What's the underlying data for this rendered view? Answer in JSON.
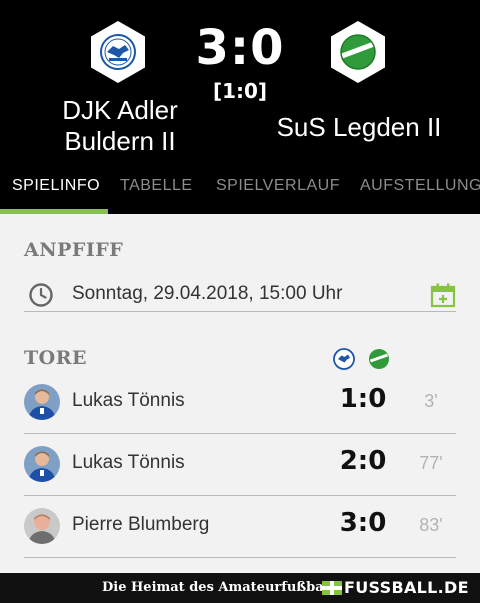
{
  "match": {
    "home_team_line1": "DJK Adler",
    "home_team_line2": "Buldern II",
    "away_team": "SuS Legden II",
    "score": "3:0",
    "halftime": "[1:0]"
  },
  "tabs": [
    "SPIELINFO",
    "TABELLE",
    "SPIELVERLAUF",
    "AUFSTELLUNG"
  ],
  "active_tab": "SPIELINFO",
  "kickoff": {
    "title": "ANPFIFF",
    "datetime": "Sonntag, 29.04.2018, 15:00 Uhr",
    "icon": "clock-icon",
    "action_icon": "calendar-add-icon"
  },
  "goals": {
    "title": "TORE",
    "items": [
      {
        "player": "Lukas Tönnis",
        "score": "1:0",
        "minute": "3'"
      },
      {
        "player": "Lukas Tönnis",
        "score": "2:0",
        "minute": "77'"
      },
      {
        "player": "Pierre Blumberg",
        "score": "3:0",
        "minute": "83'"
      }
    ]
  },
  "footer": {
    "slogan": "Die Heimat des Amateurfußballs",
    "brand": "FUSSBALL.DE"
  },
  "colors": {
    "accent": "#86c440",
    "header_bg": "#000000",
    "content_bg": "#f2f2f2",
    "home_crest": "#1e56a8",
    "away_crest": "#2f9b3a"
  }
}
